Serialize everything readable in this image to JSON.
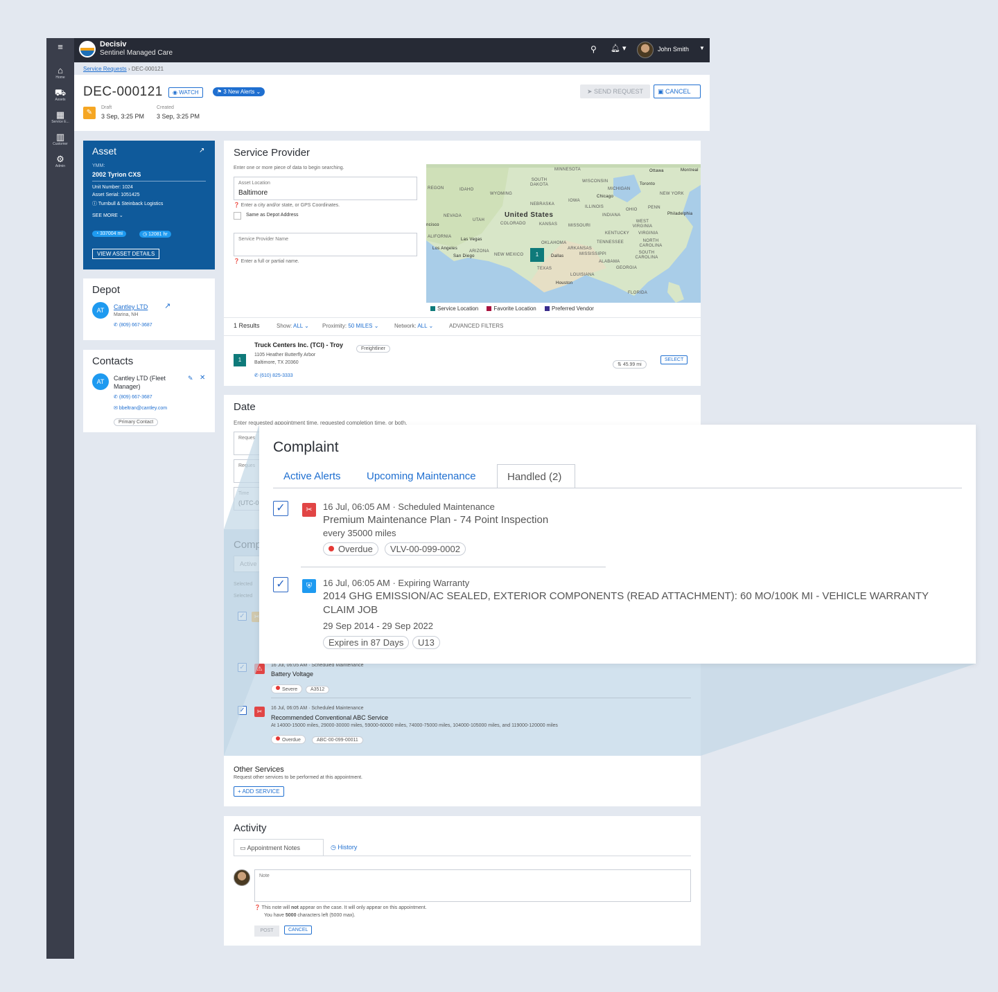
{
  "app": {
    "title": "Decisiv",
    "subtitle": "Sentinel Managed Care",
    "user": "John Smith"
  },
  "nav": [
    {
      "label": "Home",
      "icon": "home-icon"
    },
    {
      "label": "Assets",
      "icon": "truck-icon"
    },
    {
      "label": "Service E...",
      "icon": "calendar-icon"
    },
    {
      "label": "Customer",
      "icon": "building-icon"
    },
    {
      "label": "Admin",
      "icon": "gear-icon"
    }
  ],
  "breadcrumb": {
    "parent": "Service Requests",
    "current": "DEC-000121"
  },
  "header": {
    "case_id": "DEC-000121",
    "watch": "WATCH",
    "alerts": "3 New Alerts",
    "send_request": "SEND REQUEST",
    "cancel": "CANCEL",
    "status_label": "Draft",
    "status_date": "3 Sep, 3:25 PM",
    "created_label": "Created",
    "created_date": "3 Sep, 3:25 PM"
  },
  "asset": {
    "title": "Asset",
    "ymm_label": "YMM:",
    "ymm": "2002 Tyrion CXS",
    "unit": "Unit Number: 1024",
    "serial": "Asset Serial: 1051425",
    "owner": "Turnbull & Steinback Logistics",
    "see_more": "SEE MORE",
    "miles": "337004 mi",
    "hours": "12081 hr",
    "details_btn": "VIEW ASSET DETAILS"
  },
  "depot": {
    "title": "Depot",
    "initials": "AT",
    "name": "Cantley LTD",
    "location": "Marina, NH",
    "phone": "(809) 667-3687"
  },
  "contacts": {
    "title": "Contacts",
    "initials": "AT",
    "name": "Cantley LTD (Fleet Manager)",
    "phone": "(809) 667-3687",
    "email": "bbeltran@cantley.com",
    "badge": "Primary Contact"
  },
  "service_provider": {
    "title": "Service Provider",
    "intro": "Enter one or more piece of data to begin searching.",
    "location_label": "Asset Location",
    "location_value": "Baltimore",
    "location_hint": "Enter a city and/or state, or GPS Coordinates.",
    "same_as_depot": "Same as Depot Address",
    "name_label": "Service Provider Name",
    "name_hint": "Enter a full or partial name.",
    "legend": [
      "Service Location",
      "Favorite Location",
      "Preferred Vendor"
    ],
    "legend_colors": [
      "#0e7a7a",
      "#a8123e",
      "#3a2d8c"
    ],
    "map_labels": {
      "country": "United States",
      "cities": [
        "Ottawa",
        "Montreal",
        "Toronto",
        "Chicago",
        "Philadelphia",
        "Los Angeles",
        "San Diego",
        "Las Vegas",
        "Dallas",
        "Houston",
        "ncisco"
      ],
      "states": [
        "MINNESOTA",
        "WISCONSIN",
        "MICHIGAN",
        "SOUTH DAKOTA",
        "IDAHO",
        "WYOMING",
        "NEBRASKA",
        "IOWA",
        "ILLINOIS",
        "INDIANA",
        "OHIO",
        "NEVADA",
        "UTAH",
        "COLORADO",
        "KANSAS",
        "MISSOURI",
        "KENTUCKY",
        "VIRGINIA",
        "TENNESSEE",
        "OKLAHOMA",
        "ARKANSAS",
        "NEW MEXICO",
        "ARIZONA",
        "TEXAS",
        "MISSISSIPPI",
        "ALABAMA",
        "GEORGIA",
        "LOUISIANA",
        "FLORIDA",
        "NORTH CAROLINA",
        "SOUTH CAROLINA",
        "REGON",
        "ALIFORNIA",
        "NEW YORK",
        "PENN",
        "WEST VIRGINIA"
      ],
      "pin": "1"
    },
    "results_count": "1 Results",
    "show_label": "Show:",
    "show_value": "ALL",
    "proximity_label": "Proximity:",
    "proximity_value": "50 MILES",
    "network_label": "Network:",
    "network_value": "ALL",
    "advanced": "ADVANCED FILTERS",
    "result": {
      "pin": "1",
      "name": "Truck Centers Inc. (TCI) - Troy",
      "brand": "Freightliner",
      "address1": "1105 Heather Butterfly Arbor",
      "address2": "Baltimore, TX 20360",
      "phone": "(610) 825-3333",
      "distance": "45.99 mi",
      "select": "SELECT"
    }
  },
  "date": {
    "title": "Date",
    "intro": "Enter requested appointment time, requested completion time, or both.",
    "field1": "Reques",
    "field2": "Reques",
    "field3_label": "Time",
    "field3_value": "(UTC-0"
  },
  "complaint_bg": {
    "title": "Comp",
    "tab": "Active",
    "selected1": "Selected",
    "selected2": "Selected",
    "items": [
      {
        "meta": "16 Jul, 06:05 AM · Scheduled Maintenance",
        "title": "Battery Voltage",
        "chips": [
          "Severe",
          "A3512"
        ]
      },
      {
        "meta": "16 Jul, 06:05 AM · Scheduled Maintenance",
        "title": "Recommended Conventional ABC Service",
        "desc": "At 14000-15000 miles, 29000-30000 miles, 59000-60000 miles, 74000-75000 miles, 104000-105000 miles, and 119000-120000 miles",
        "chips": [
          "Overdue",
          "ABC-00-099-00011"
        ]
      }
    ]
  },
  "complaint_zoom": {
    "title": "Complaint",
    "tabs": [
      "Active Alerts",
      "Upcoming Maintenance",
      "Handled (2)"
    ],
    "items": [
      {
        "meta": "16 Jul, 06:05 AM · Scheduled Maintenance",
        "title": "Premium Maintenance Plan - 74 Point Inspection",
        "sub": "every 35000 miles",
        "chips": [
          "Overdue",
          "VLV-00-099-0002"
        ]
      },
      {
        "meta": "16 Jul, 06:05 AM · Expiring Warranty",
        "title": "2014 GHG EMISSION/AC SEALED, EXTERIOR COMPONENTS (READ ATTACHMENT): 60 MO/100K MI - VEHICLE WARRANTY CLAIM JOB",
        "sub": "29 Sep 2014 - 29 Sep 2022",
        "chips": [
          "Expires in 87 Days",
          "U13"
        ]
      }
    ]
  },
  "other_services": {
    "title": "Other Services",
    "desc": "Request other services to be performed at this appointment.",
    "add": "+ ADD SERVICE"
  },
  "activity": {
    "title": "Activity",
    "tab_notes": "Appointment Notes",
    "tab_history": "History",
    "note_placeholder": "Note",
    "hint_pre": "This note will ",
    "hint_bold": "not",
    "hint_post": " appear on the case. It will only appear on this appointment.",
    "chars_pre": "You have ",
    "chars_bold": "5000",
    "chars_post": " characters left (5000 max).",
    "post": "POST",
    "cancel": "CANCEL"
  }
}
